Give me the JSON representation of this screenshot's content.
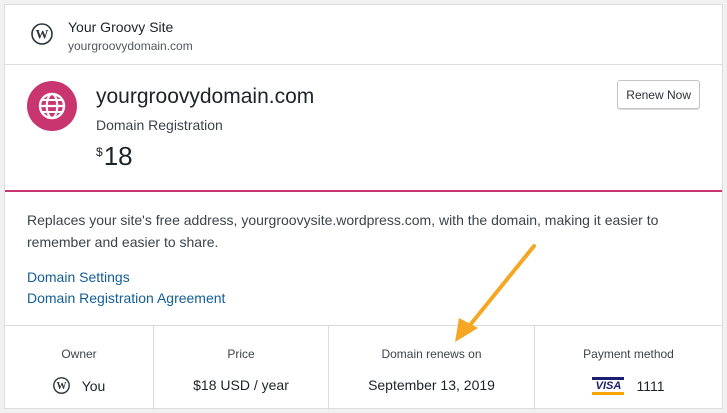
{
  "site": {
    "name": "Your Groovy Site",
    "url": "yourgroovydomain.com",
    "icon": "wordpress-logo-icon"
  },
  "product": {
    "domain": "yourgroovydomain.com",
    "type": "Domain Registration",
    "currency_symbol": "$",
    "price": "18",
    "renew_label": "Renew Now",
    "icon": "globe-icon",
    "accent_color": "#c9356e"
  },
  "description": "Replaces your site's free address, yourgroovysite.wordpress.com, with the domain, making it easier to remember and easier to share.",
  "links": {
    "settings": "Domain Settings",
    "agreement": "Domain Registration Agreement"
  },
  "stats": {
    "owner_label": "Owner",
    "owner_value": "You",
    "price_label": "Price",
    "price_value": "$18 USD / year",
    "renews_label": "Domain renews on",
    "renews_value": "September 13, 2019",
    "payment_label": "Payment method",
    "card_brand": "VISA",
    "card_last4": "1111"
  },
  "annotation": {
    "arrow_color": "#f5a623"
  }
}
